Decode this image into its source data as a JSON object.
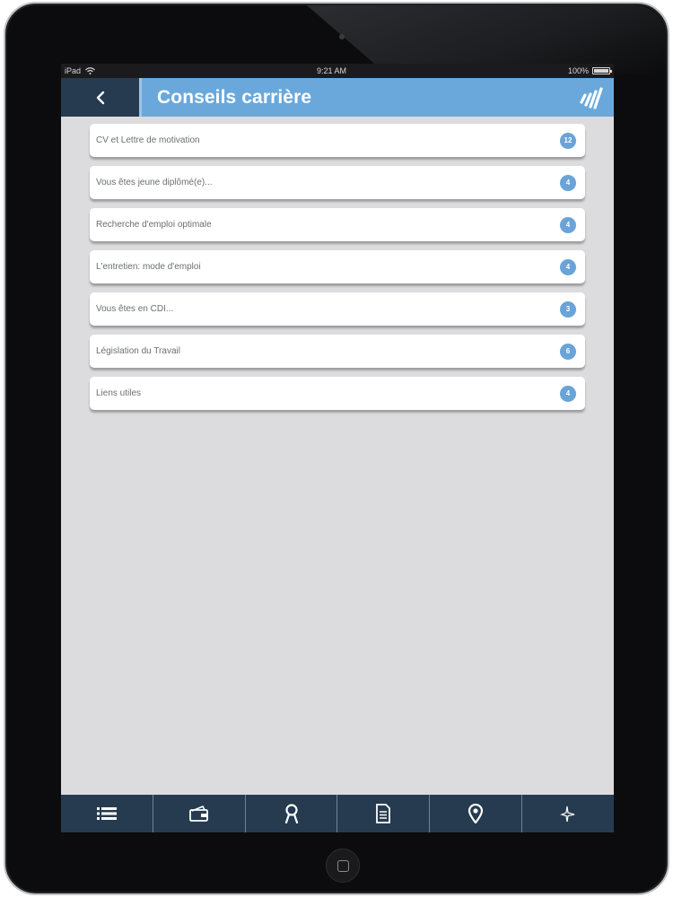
{
  "status_bar": {
    "device": "iPad",
    "time": "9:21 AM",
    "battery": "100%"
  },
  "nav": {
    "title": "Conseils carrière",
    "back_icon": "chevron-left-icon",
    "logo_icon": "brand-logo-icon"
  },
  "items": [
    {
      "label": "CV et Lettre de motivation",
      "count": "12"
    },
    {
      "label": "Vous êtes jeune diplômé(e)...",
      "count": "4"
    },
    {
      "label": "Recherche d'emploi optimale",
      "count": "4"
    },
    {
      "label": "L'entretien: mode d'emploi",
      "count": "4"
    },
    {
      "label": "Vous êtes en CDI...",
      "count": "3"
    },
    {
      "label": "Législation du Travail",
      "count": "6"
    },
    {
      "label": "Liens utiles",
      "count": "4"
    }
  ],
  "tabs": [
    {
      "icon": "list-icon"
    },
    {
      "icon": "wallet-icon"
    },
    {
      "icon": "profile-icon"
    },
    {
      "icon": "document-icon"
    },
    {
      "icon": "location-pin-icon"
    },
    {
      "icon": "sparkle-icon"
    }
  ],
  "colors": {
    "accent": "#6aa8dc",
    "navy": "#263b50",
    "background": "#dcdcde"
  }
}
